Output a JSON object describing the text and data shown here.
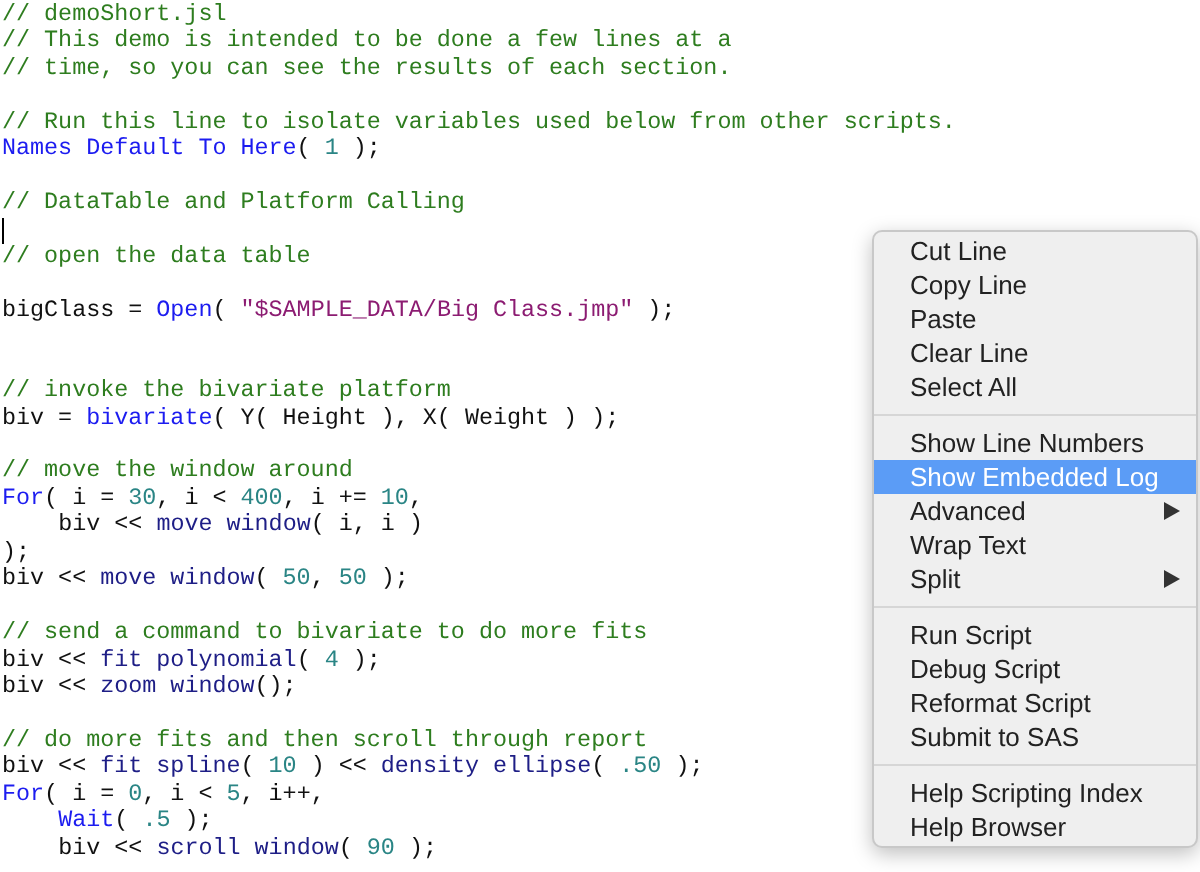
{
  "editor": {
    "lines": [
      {
        "kind": "code",
        "tokens": [
          {
            "kind": "comment",
            "text": "// demoShort.jsl"
          }
        ]
      },
      {
        "kind": "code",
        "tokens": [
          {
            "kind": "comment",
            "text": "// This demo is intended to be done a few lines at a"
          }
        ]
      },
      {
        "kind": "code",
        "tokens": [
          {
            "kind": "comment",
            "text": "// time, so you can see the results of each section."
          }
        ]
      },
      {
        "kind": "blank"
      },
      {
        "kind": "code",
        "tokens": [
          {
            "kind": "comment",
            "text": "// Run this line to isolate variables used below from other scripts."
          }
        ]
      },
      {
        "kind": "code",
        "tokens": [
          {
            "kind": "keyword",
            "text": "Names Default To Here"
          },
          {
            "kind": "plain",
            "text": "( "
          },
          {
            "kind": "number",
            "text": "1"
          },
          {
            "kind": "plain",
            "text": " );"
          }
        ]
      },
      {
        "kind": "blank"
      },
      {
        "kind": "code",
        "tokens": [
          {
            "kind": "comment",
            "text": "// DataTable and Platform Calling"
          }
        ]
      },
      {
        "kind": "cursor"
      },
      {
        "kind": "code",
        "tokens": [
          {
            "kind": "comment",
            "text": "// open the data table"
          }
        ]
      },
      {
        "kind": "blank"
      },
      {
        "kind": "code",
        "tokens": [
          {
            "kind": "plain",
            "text": "bigClass = "
          },
          {
            "kind": "keyword",
            "text": "Open"
          },
          {
            "kind": "plain",
            "text": "( "
          },
          {
            "kind": "string",
            "text": "\"$SAMPLE_DATA/Big Class.jmp\""
          },
          {
            "kind": "plain",
            "text": " );"
          }
        ]
      },
      {
        "kind": "blank"
      },
      {
        "kind": "blank"
      },
      {
        "kind": "code",
        "tokens": [
          {
            "kind": "comment",
            "text": "// invoke the bivariate platform"
          }
        ]
      },
      {
        "kind": "code",
        "tokens": [
          {
            "kind": "plain",
            "text": "biv = "
          },
          {
            "kind": "keyword",
            "text": "bivariate"
          },
          {
            "kind": "plain",
            "text": "( Y( Height ), X( Weight ) );"
          }
        ]
      },
      {
        "kind": "blank"
      },
      {
        "kind": "code",
        "tokens": [
          {
            "kind": "comment",
            "text": "// move the window around"
          }
        ]
      },
      {
        "kind": "code",
        "tokens": [
          {
            "kind": "keyword",
            "text": "For"
          },
          {
            "kind": "plain",
            "text": "( i = "
          },
          {
            "kind": "number",
            "text": "30"
          },
          {
            "kind": "plain",
            "text": ", i < "
          },
          {
            "kind": "number",
            "text": "400"
          },
          {
            "kind": "plain",
            "text": ", i += "
          },
          {
            "kind": "number",
            "text": "10"
          },
          {
            "kind": "plain",
            "text": ","
          }
        ]
      },
      {
        "kind": "code",
        "indented": true,
        "tokens": [
          {
            "kind": "plain",
            "text": "biv << "
          },
          {
            "kind": "message",
            "text": "move window"
          },
          {
            "kind": "plain",
            "text": "( i, i )"
          }
        ]
      },
      {
        "kind": "code",
        "tokens": [
          {
            "kind": "plain",
            "text": ");"
          }
        ]
      },
      {
        "kind": "code",
        "tokens": [
          {
            "kind": "plain",
            "text": "biv << "
          },
          {
            "kind": "message",
            "text": "move window"
          },
          {
            "kind": "plain",
            "text": "( "
          },
          {
            "kind": "number",
            "text": "50"
          },
          {
            "kind": "plain",
            "text": ", "
          },
          {
            "kind": "number",
            "text": "50"
          },
          {
            "kind": "plain",
            "text": " );"
          }
        ]
      },
      {
        "kind": "blank"
      },
      {
        "kind": "code",
        "tokens": [
          {
            "kind": "comment",
            "text": "// send a command to bivariate to do more fits"
          }
        ]
      },
      {
        "kind": "code",
        "tokens": [
          {
            "kind": "plain",
            "text": "biv << "
          },
          {
            "kind": "message",
            "text": "fit polynomial"
          },
          {
            "kind": "plain",
            "text": "( "
          },
          {
            "kind": "number",
            "text": "4"
          },
          {
            "kind": "plain",
            "text": " );"
          }
        ]
      },
      {
        "kind": "code",
        "tokens": [
          {
            "kind": "plain",
            "text": "biv << "
          },
          {
            "kind": "message",
            "text": "zoom window"
          },
          {
            "kind": "plain",
            "text": "();"
          }
        ]
      },
      {
        "kind": "blank"
      },
      {
        "kind": "code",
        "tokens": [
          {
            "kind": "comment",
            "text": "// do more fits and then scroll through report"
          }
        ]
      },
      {
        "kind": "code",
        "tokens": [
          {
            "kind": "plain",
            "text": "biv << "
          },
          {
            "kind": "message",
            "text": "fit spline"
          },
          {
            "kind": "plain",
            "text": "( "
          },
          {
            "kind": "number",
            "text": "10"
          },
          {
            "kind": "plain",
            "text": " ) << "
          },
          {
            "kind": "message",
            "text": "density ellipse"
          },
          {
            "kind": "plain",
            "text": "( "
          },
          {
            "kind": "number",
            "text": ".50"
          },
          {
            "kind": "plain",
            "text": " );"
          }
        ]
      },
      {
        "kind": "code",
        "tokens": [
          {
            "kind": "keyword",
            "text": "For"
          },
          {
            "kind": "plain",
            "text": "( i = "
          },
          {
            "kind": "number",
            "text": "0"
          },
          {
            "kind": "plain",
            "text": ", i < "
          },
          {
            "kind": "number",
            "text": "5"
          },
          {
            "kind": "plain",
            "text": ", i++,"
          }
        ]
      },
      {
        "kind": "code",
        "indented": true,
        "tokens": [
          {
            "kind": "keyword",
            "text": "Wait"
          },
          {
            "kind": "plain",
            "text": "( "
          },
          {
            "kind": "number",
            "text": ".5"
          },
          {
            "kind": "plain",
            "text": " );"
          }
        ]
      },
      {
        "kind": "code",
        "indented": true,
        "tokens": [
          {
            "kind": "plain",
            "text": "biv << "
          },
          {
            "kind": "message",
            "text": "scroll window"
          },
          {
            "kind": "plain",
            "text": "( "
          },
          {
            "kind": "number",
            "text": "90"
          },
          {
            "kind": "plain",
            "text": " );"
          }
        ]
      }
    ]
  },
  "context_menu": {
    "sections": [
      [
        {
          "label": "Cut Line",
          "selected": false,
          "submenu": false
        },
        {
          "label": "Copy Line",
          "selected": false,
          "submenu": false
        },
        {
          "label": "Paste",
          "selected": false,
          "submenu": false
        },
        {
          "label": "Clear Line",
          "selected": false,
          "submenu": false
        },
        {
          "label": "Select All",
          "selected": false,
          "submenu": false
        }
      ],
      [
        {
          "label": "Show Line Numbers",
          "selected": false,
          "submenu": false
        },
        {
          "label": "Show Embedded Log",
          "selected": true,
          "submenu": false
        },
        {
          "label": "Advanced",
          "selected": false,
          "submenu": true
        },
        {
          "label": "Wrap Text",
          "selected": false,
          "submenu": false
        },
        {
          "label": "Split",
          "selected": false,
          "submenu": true
        }
      ],
      [
        {
          "label": "Run Script",
          "selected": false,
          "submenu": false
        },
        {
          "label": "Debug Script",
          "selected": false,
          "submenu": false
        },
        {
          "label": "Reformat Script",
          "selected": false,
          "submenu": false
        },
        {
          "label": "Submit to SAS",
          "selected": false,
          "submenu": false
        }
      ],
      [
        {
          "label": "Help Scripting Index",
          "selected": false,
          "submenu": false
        },
        {
          "label": "Help Browser",
          "selected": false,
          "submenu": false
        }
      ]
    ]
  }
}
